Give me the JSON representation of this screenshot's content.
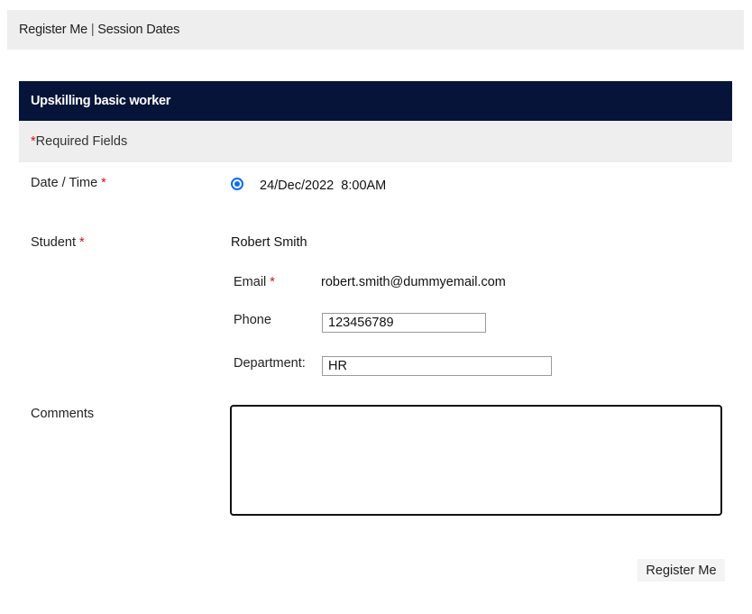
{
  "breadcrumb": {
    "register": "Register Me",
    "separator": "|",
    "session_dates": "Session Dates"
  },
  "panel": {
    "title": "Upskilling basic worker",
    "required_note": "Required Fields",
    "required_star": "*"
  },
  "form": {
    "datetime": {
      "label": "Date / Time",
      "required": "*",
      "option": "24/Dec/2022  8:00AM",
      "selected": true
    },
    "student": {
      "label": "Student",
      "required": "*",
      "name": "Robert Smith"
    },
    "email": {
      "label": "Email",
      "required": "*",
      "value": "robert.smith@dummyemail.com"
    },
    "phone": {
      "label": "Phone",
      "value": "123456789"
    },
    "department": {
      "label": "Department:",
      "value": "HR"
    },
    "comments": {
      "label": "Comments",
      "value": ""
    }
  },
  "actions": {
    "submit_label": "Register Me"
  },
  "colors": {
    "header_bg": "#06143a",
    "required": "#cc1111",
    "radio": "#0b6bf0"
  }
}
